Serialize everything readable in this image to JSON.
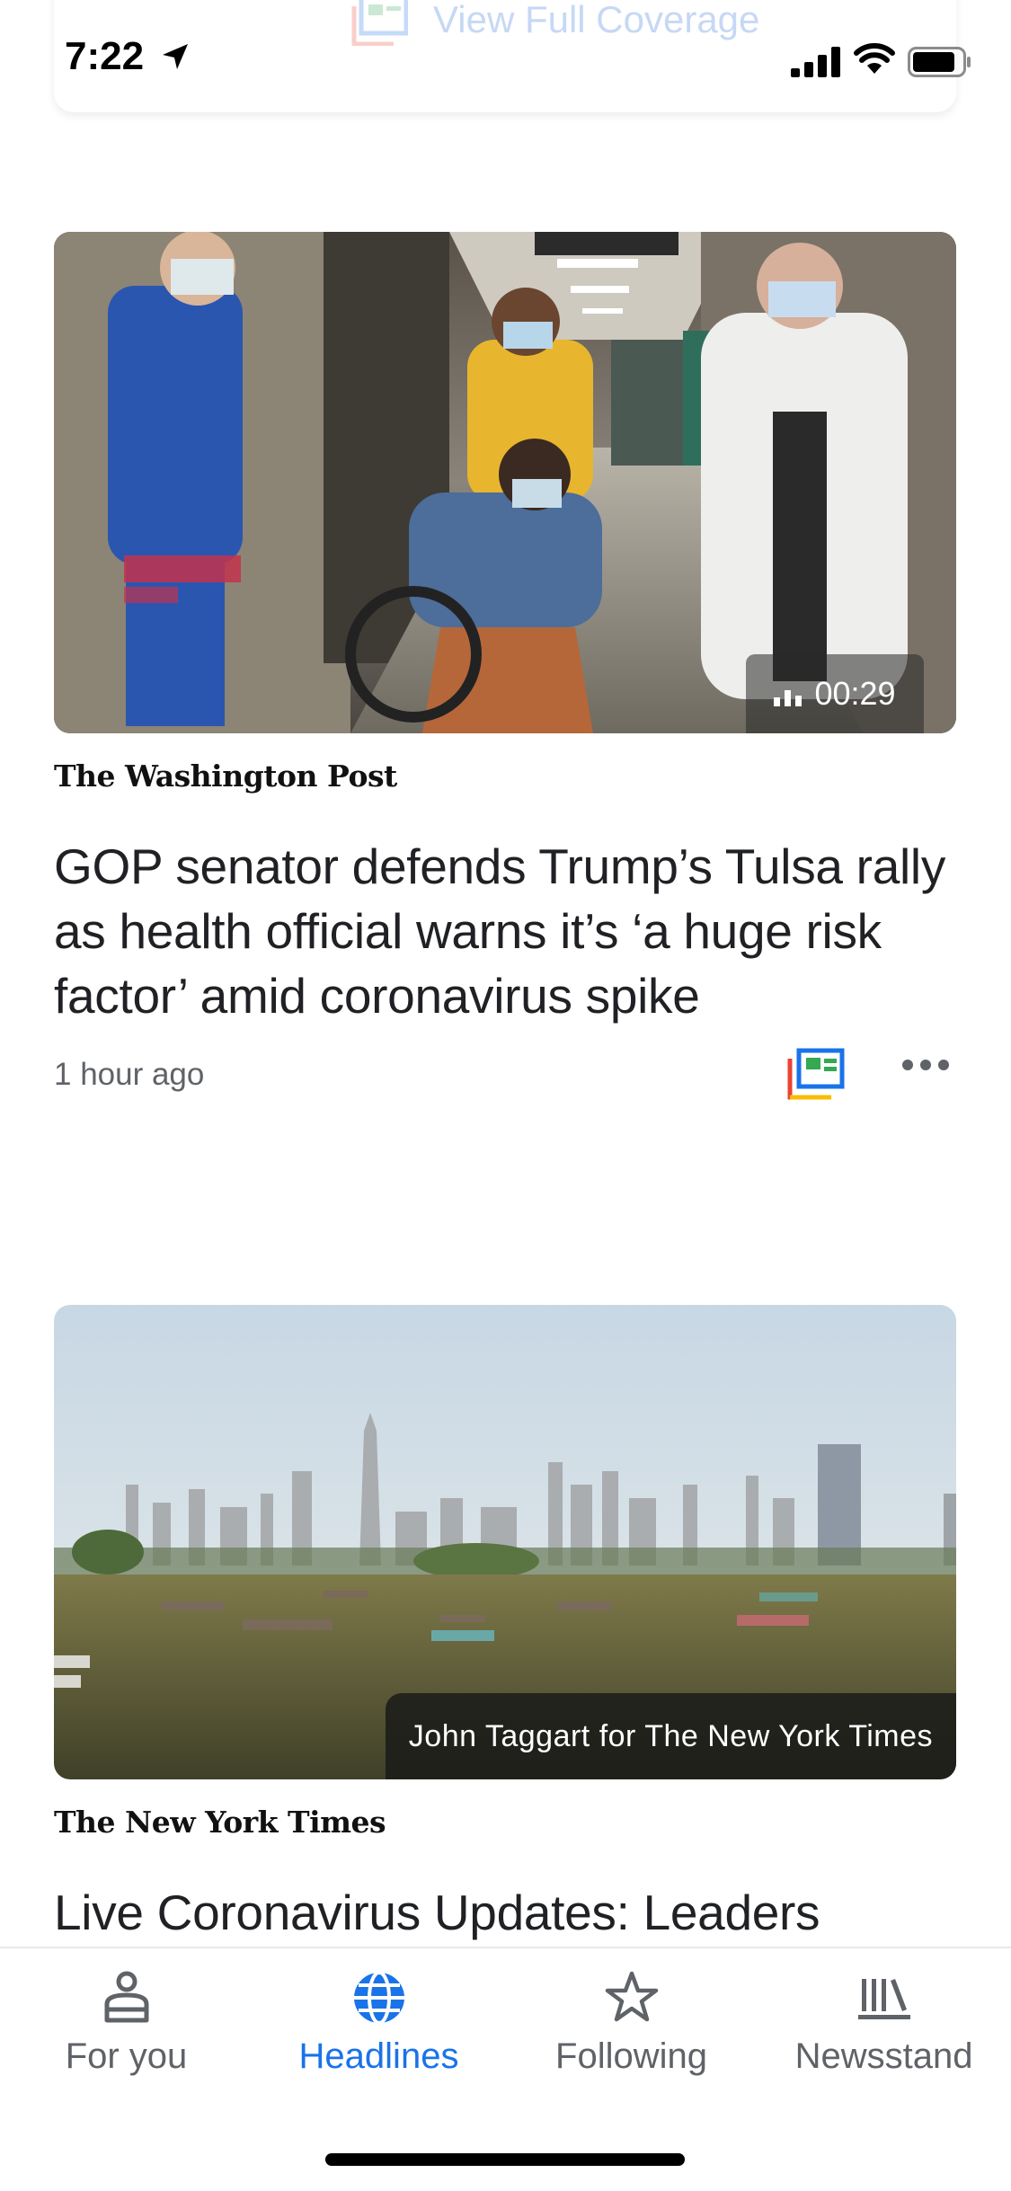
{
  "status_bar": {
    "time": "7:22"
  },
  "top_card": {
    "view_full_coverage": "View Full Coverage"
  },
  "articles": [
    {
      "publisher": "The Washington Post",
      "headline": "GOP senator defends Trump’s Tulsa rally as health official warns it’s ‘a huge risk factor’ amid coronavirus spike",
      "time_ago": "1 hour ago",
      "video_duration": "00:29"
    },
    {
      "publisher": "The New York Times",
      "headline": "Live Coronavirus Updates: Leaders",
      "image_caption": "John Taggart for The New York Times"
    }
  ],
  "bottom_nav": {
    "items": [
      {
        "label": "For you",
        "icon": "person-icon",
        "active": false
      },
      {
        "label": "Headlines",
        "icon": "globe-icon",
        "active": true
      },
      {
        "label": "Following",
        "icon": "star-icon",
        "active": false
      },
      {
        "label": "Newsstand",
        "icon": "newsstand-icon",
        "active": false
      }
    ]
  },
  "colors": {
    "accent": "#1a73e8",
    "text_primary": "#202124",
    "text_secondary": "#5f6368"
  }
}
